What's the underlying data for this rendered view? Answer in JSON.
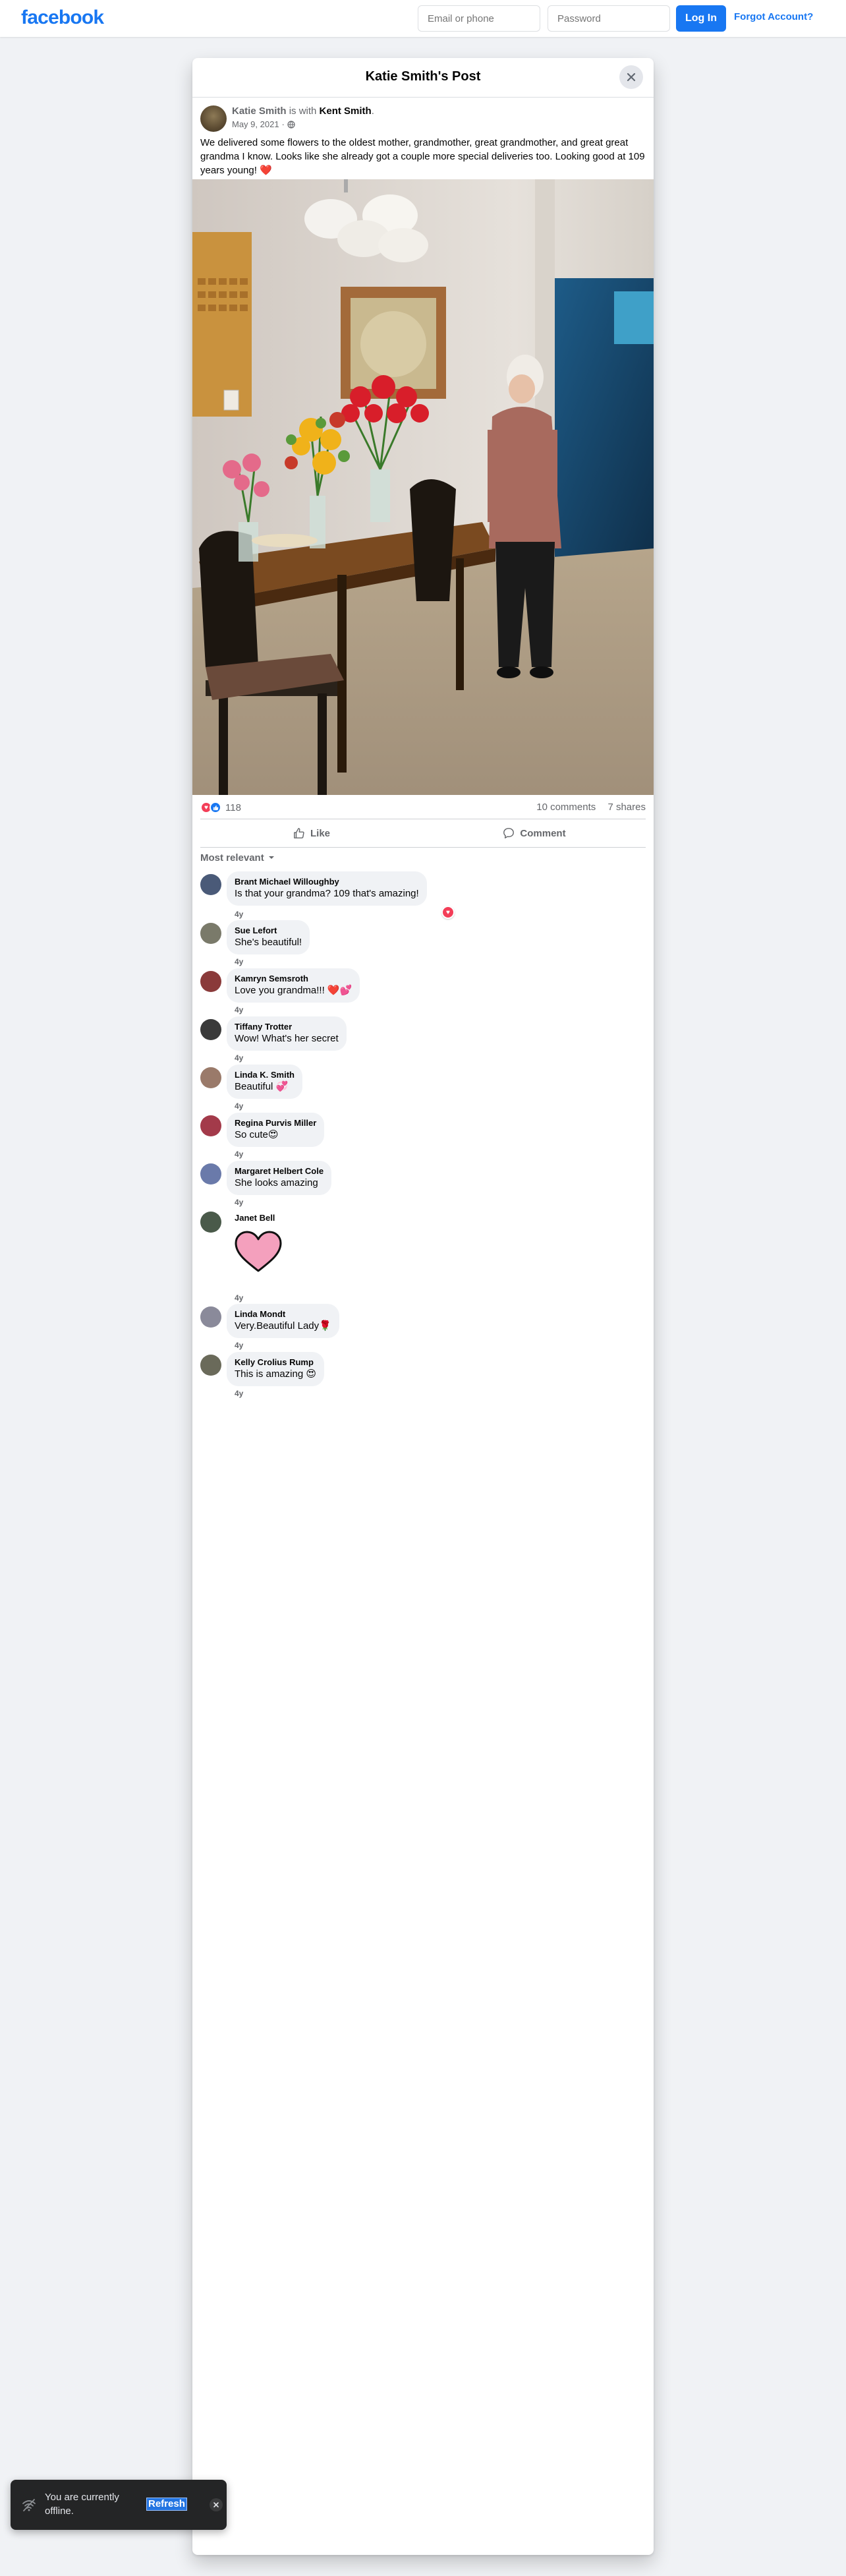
{
  "nav": {
    "logo": "facebook",
    "email_placeholder": "Email or phone",
    "password_placeholder": "Password",
    "login_label": "Log In",
    "forgot_label": "Forgot Account?"
  },
  "dialog": {
    "title": "Katie Smith's Post",
    "close_icon": "close-icon"
  },
  "post": {
    "author": "Katie Smith",
    "with_text": "is with",
    "tagged": "Kent Smith",
    "date": "May 9, 2021",
    "privacy_icon": "globe-icon",
    "text": "We delivered some flowers to the oldest mother, grandmother, great grandmother, and great great grandma I know. Looks like she already got a couple more special deliveries too. Looking good at 109 years young! ❤️",
    "reaction_count": "118",
    "comments_count": "10 comments",
    "shares_count": "7 shares",
    "like_label": "Like",
    "comment_label": "Comment",
    "sort_label": "Most relevant"
  },
  "comments": [
    {
      "name": "Brant Michael Willoughby",
      "text": "Is that your grandma? 109 that's amazing!",
      "time": "4y",
      "avatar_color": "#4a5a78",
      "reaction": "love"
    },
    {
      "name": "Sue Lefort",
      "text": "She's beautiful!",
      "time": "4y",
      "avatar_color": "#7a7a6a"
    },
    {
      "name": "Kamryn Semsroth",
      "text": "Love you grandma!!! ❤️💕",
      "time": "4y",
      "avatar_color": "#8a3a3a"
    },
    {
      "name": "Tiffany Trotter",
      "text": "Wow! What's her secret",
      "time": "4y",
      "avatar_color": "#3a3a3a"
    },
    {
      "name": "Linda K. Smith",
      "text": "Beautiful 💞",
      "time": "4y",
      "avatar_color": "#9a7a6a"
    },
    {
      "name": "Regina Purvis Miller",
      "text": "So cute😍",
      "time": "4y",
      "avatar_color": "#a33a4a"
    },
    {
      "name": "Margaret Helbert Cole",
      "text": "She looks amazing",
      "time": "4y",
      "avatar_color": "#6a7aaa"
    },
    {
      "name": "Janet Bell",
      "text": "",
      "time": "4y",
      "avatar_color": "#4a5a4a",
      "sticker": "heart-sticker"
    },
    {
      "name": "Linda Mondt",
      "text": "Very.Beautiful Lady🌹",
      "time": "4y",
      "avatar_color": "#8a8a9a"
    },
    {
      "name": "Kelly Crolius Rump",
      "text": "This is amazing 😍",
      "time": "4y",
      "avatar_color": "#6a6a5a"
    }
  ],
  "toast": {
    "message": "You are currently offline.",
    "refresh_label": "Refresh",
    "wifi_off_icon": "wifi-off-icon",
    "close_icon": "close-icon"
  },
  "colors": {
    "brand": "#1877f2",
    "love": "#f33e58",
    "background": "#f0f2f5"
  }
}
